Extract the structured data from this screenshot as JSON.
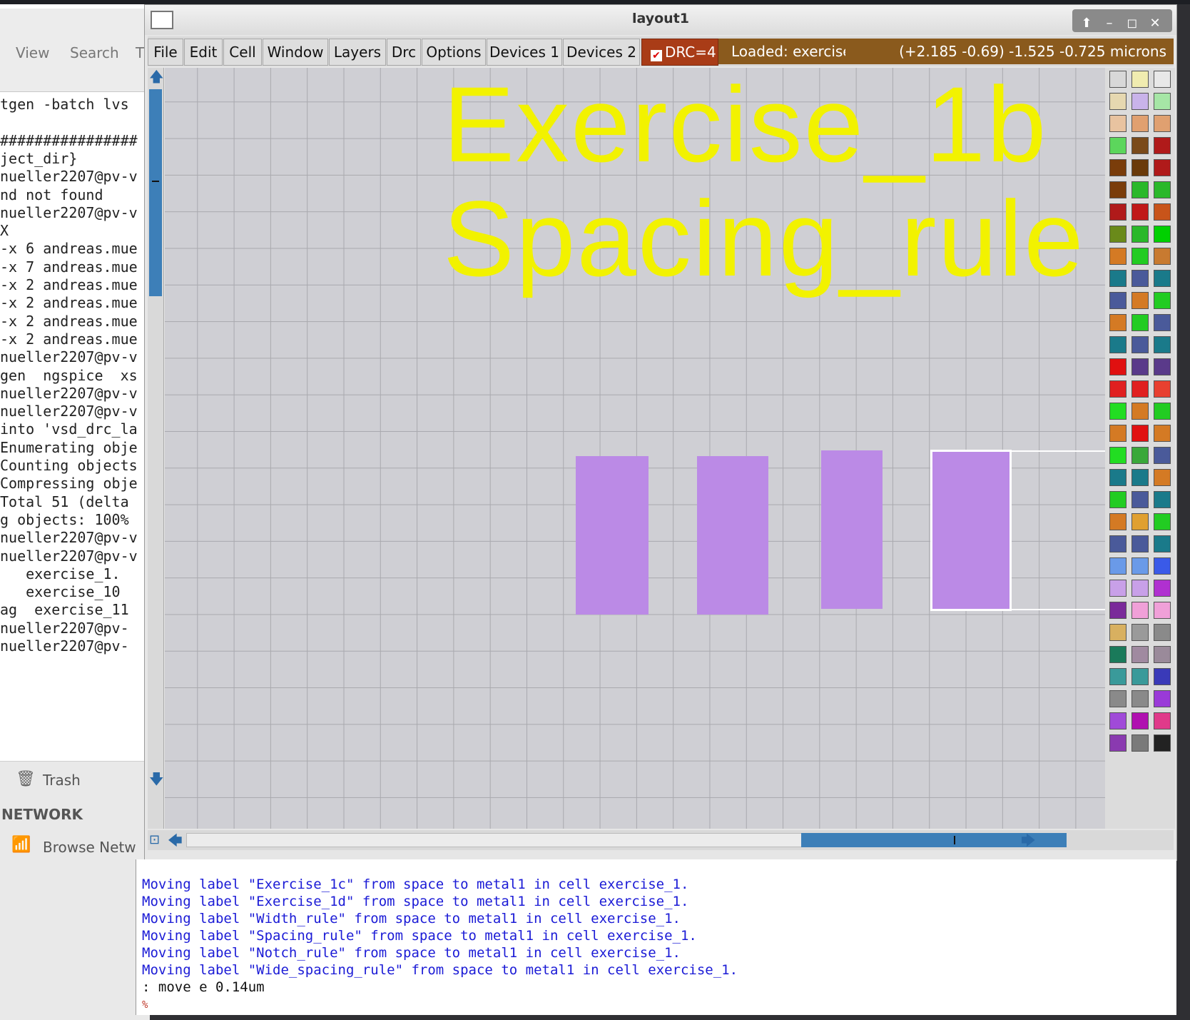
{
  "filemanager": {
    "menu": [
      "View",
      "Search",
      "T"
    ],
    "sidebar": {
      "trash": "Trash",
      "network_heading": "NETWORK",
      "browse": "Browse Netw"
    }
  },
  "terminal": {
    "lines": [
      "tgen -batch lvs",
      "",
      "################",
      "ject_dir}",
      "nueller2207@pv-v",
      "nd not found",
      "nueller2207@pv-v",
      "X",
      "-x 6 andreas.mue",
      "-x 7 andreas.mue",
      "-x 2 andreas.mue",
      "-x 2 andreas.mue",
      "-x 2 andreas.mue",
      "-x 2 andreas.mue",
      "nueller2207@pv-v",
      "gen  ngspice  xs",
      "nueller2207@pv-v",
      "nueller2207@pv-v",
      "into 'vsd_drc_la",
      "Enumerating obje",
      "Counting objects",
      "Compressing obje",
      "Total 51 (delta",
      "g objects: 100%",
      "nueller2207@pv-v",
      "nueller2207@pv-v",
      "   exercise_1.",
      "   exercise_10",
      "ag  exercise_11",
      "nueller2207@pv-",
      "nueller2207@pv-"
    ]
  },
  "window": {
    "title": "layout1",
    "buttons": {
      "up": "⬆",
      "minimize": "–",
      "maximize": "◻",
      "close": "✕"
    }
  },
  "menubar": {
    "items": [
      "File",
      "Edit",
      "Cell",
      "Window",
      "Layers",
      "Drc",
      "Options",
      "Devices 1",
      "Devices 2"
    ],
    "drc_label": "DRC=4",
    "status_loaded": "Loaded: exercise",
    "coords": "(+2.185 -0.69) -1.525 -0.725 microns"
  },
  "canvas": {
    "labels": [
      "Exercise_1b",
      "Spacing_rule"
    ],
    "layer_color": "#bb8ae6",
    "label_color": "#f2f200",
    "grid_color": "#a9a9ae",
    "background": "#cfcfd4"
  },
  "console": {
    "lines": [
      "Moving label \"Exercise_1c\" from space to metal1 in cell exercise_1.",
      "Moving label \"Exercise_1d\" from space to metal1 in cell exercise_1.",
      "Moving label \"Width_rule\" from space to metal1 in cell exercise_1.",
      "Moving label \"Spacing_rule\" from space to metal1 in cell exercise_1.",
      "Moving label \"Notch_rule\" from space to metal1 in cell exercise_1.",
      "Moving label \"Wide_spacing_rule\" from space to metal1 in cell exercise_1."
    ],
    "command": ": move e 0.14um",
    "prompt": "%"
  }
}
